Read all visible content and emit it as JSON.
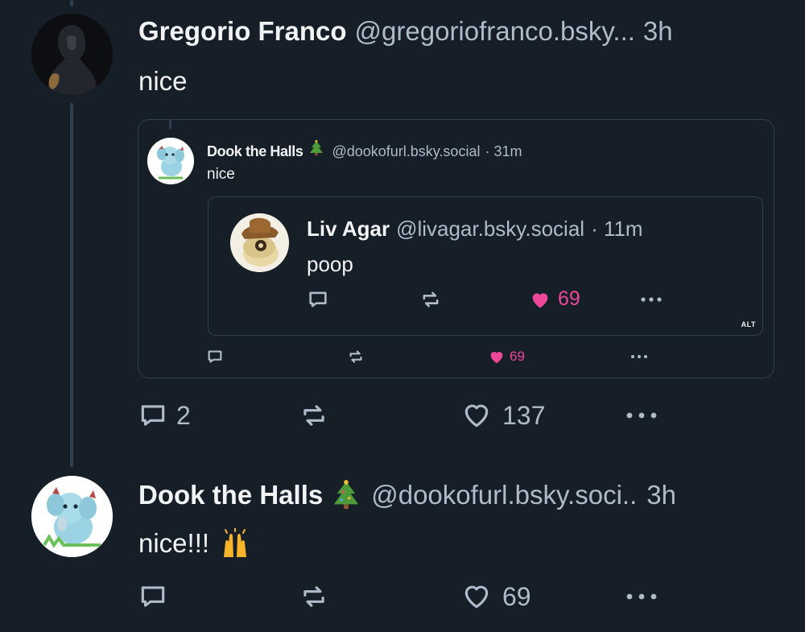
{
  "post1": {
    "author_name": "Gregorio Franco",
    "author_handle": "@gregoriofranco.bsky...",
    "time": "3h",
    "text": "nice",
    "quote": {
      "author_name": "Dook the Halls",
      "author_handle": "@dookofurl.bsky.social",
      "time": "· 31m",
      "text": "nice",
      "nested_quote": {
        "author_name": "Liv Agar",
        "author_handle": "@livagar.bsky.social",
        "time": "· 11m",
        "text": "poop",
        "like_count": "69",
        "alt_badge": "ALT"
      },
      "like_count": "69"
    },
    "reply_count": "2",
    "like_count": "137"
  },
  "post2": {
    "author_name": "Dook the Halls",
    "author_handle": "@dookofurl.bsky.soci..",
    "time": "3h",
    "text": "nice!!!",
    "like_count": "69"
  },
  "icons": {
    "reply": "comment-bubble-icon",
    "repost": "repost-arrows-icon",
    "like": "heart-icon",
    "more": "more-dots-icon",
    "tree": "christmas-tree-emoji",
    "hands": "raised-hands-emoji"
  },
  "colors": {
    "background": "#161e27",
    "border": "#2e4052",
    "text": "#f1f3f5",
    "muted": "#aebbc9",
    "like_pink": "#ec4899"
  }
}
